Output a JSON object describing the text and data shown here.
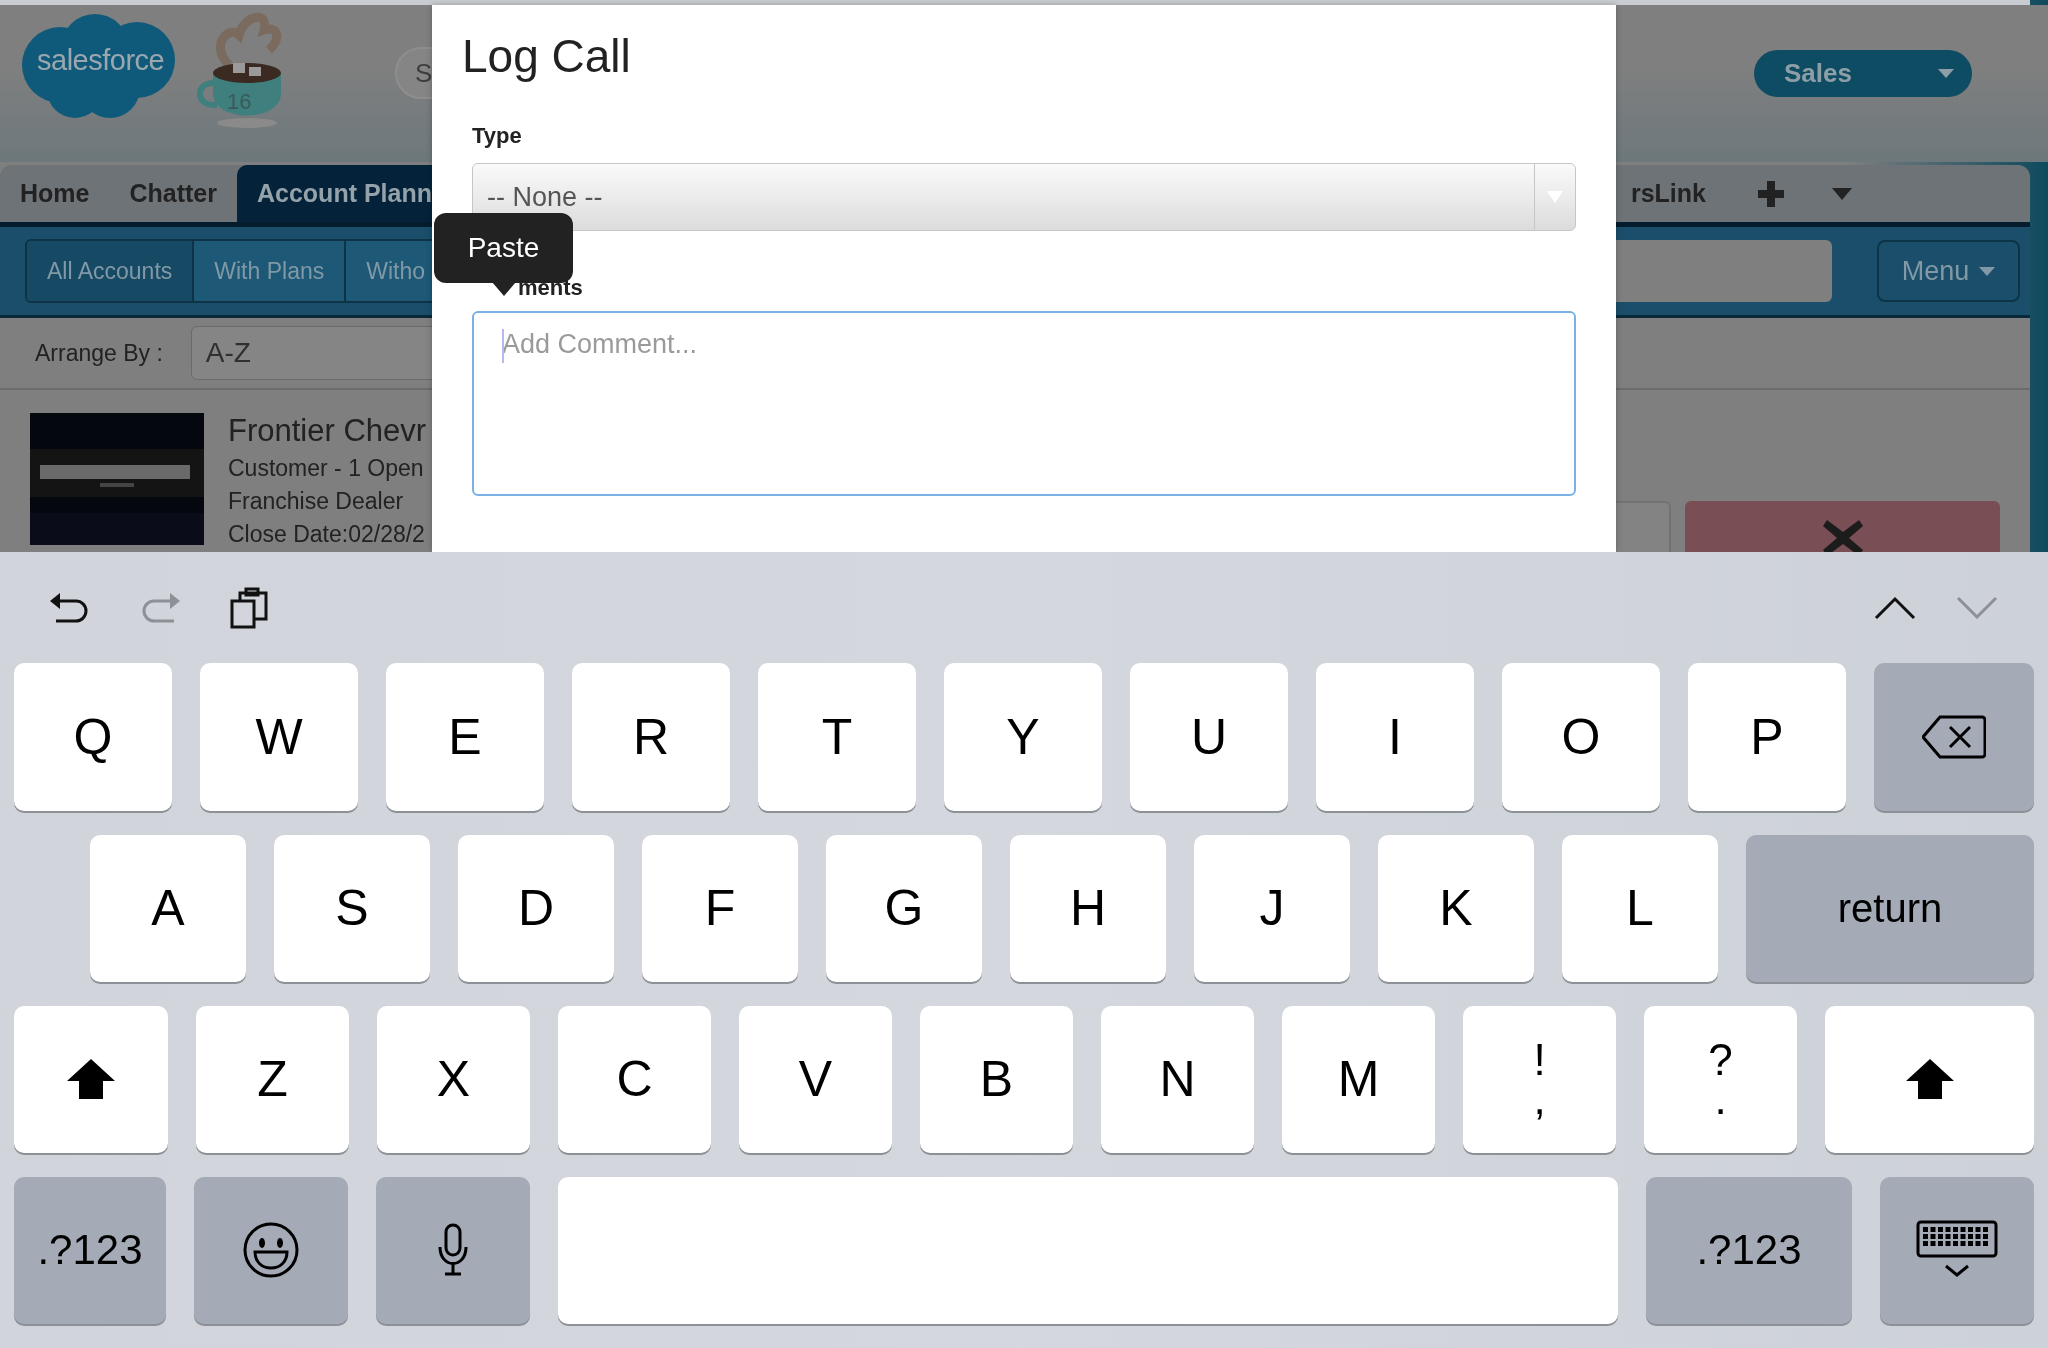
{
  "header": {
    "logo_text": "salesforce",
    "mug_badge": "16",
    "search_placeholder": "S",
    "app_menu": "Sales"
  },
  "nav_tabs": [
    {
      "label": "Home",
      "selected": false
    },
    {
      "label": "Chatter",
      "selected": false
    },
    {
      "label": "Account Plann",
      "selected": true
    }
  ],
  "nav_tabs_right": [
    {
      "label": "rsLink",
      "selected": false
    }
  ],
  "filter_tabs": [
    {
      "label": "All Accounts",
      "selected": true
    },
    {
      "label": "With Plans",
      "selected": false
    },
    {
      "label": "Witho",
      "selected": false
    }
  ],
  "menu_button": "Menu",
  "arrange": {
    "label": "Arrange By :",
    "value": "A-Z"
  },
  "accounts": [
    {
      "kind": "picture",
      "name": "Frontier Chevr",
      "lines": [
        "Customer - 1 Open",
        "Franchise Dealer",
        "Close Date:02/28/2"
      ]
    }
  ],
  "dialog": {
    "title": "Log Call",
    "type_label": "Type",
    "type_value": "-- None --",
    "comments_label": "ments",
    "comments_placeholder": "Add Comment..."
  },
  "tooltip": "Paste",
  "keyboard": {
    "toolbar": [
      {
        "kind": "undo",
        "disabled": false
      },
      {
        "kind": "redo",
        "disabled": true
      },
      {
        "kind": "paste",
        "disabled": false
      }
    ],
    "nav": [
      {
        "kind": "previous",
        "disabled": false
      },
      {
        "kind": "next",
        "disabled": true
      }
    ],
    "rows": [
      {
        "keys": [
          {
            "kind": "letter",
            "label": "Q"
          },
          {
            "kind": "letter",
            "label": "W"
          },
          {
            "kind": "letter",
            "label": "E"
          },
          {
            "kind": "letter",
            "label": "R"
          },
          {
            "kind": "letter",
            "label": "T"
          },
          {
            "kind": "letter",
            "label": "Y"
          },
          {
            "kind": "letter",
            "label": "U"
          },
          {
            "kind": "letter",
            "label": "I"
          },
          {
            "kind": "letter",
            "label": "O"
          },
          {
            "kind": "letter",
            "label": "P"
          },
          {
            "kind": "backspace"
          }
        ]
      },
      {
        "keys": [
          {
            "kind": "letter",
            "label": "A"
          },
          {
            "kind": "letter",
            "label": "S"
          },
          {
            "kind": "letter",
            "label": "D"
          },
          {
            "kind": "letter",
            "label": "F"
          },
          {
            "kind": "letter",
            "label": "G"
          },
          {
            "kind": "letter",
            "label": "H"
          },
          {
            "kind": "letter",
            "label": "J"
          },
          {
            "kind": "letter",
            "label": "K"
          },
          {
            "kind": "letter",
            "label": "L"
          },
          {
            "kind": "return",
            "label": "return"
          }
        ]
      },
      {
        "keys": [
          {
            "kind": "shift"
          },
          {
            "kind": "letter",
            "label": "Z"
          },
          {
            "kind": "letter",
            "label": "X"
          },
          {
            "kind": "letter",
            "label": "C"
          },
          {
            "kind": "letter",
            "label": "V"
          },
          {
            "kind": "letter",
            "label": "B"
          },
          {
            "kind": "letter",
            "label": "N"
          },
          {
            "kind": "letter",
            "label": "M"
          },
          {
            "kind": "dual",
            "top": "!",
            "bottom": ","
          },
          {
            "kind": "dual",
            "top": "?",
            "bottom": "."
          },
          {
            "kind": "shift_right"
          }
        ]
      },
      {
        "keys": [
          {
            "kind": "numbers",
            "label": ".?123"
          },
          {
            "kind": "emoji"
          },
          {
            "kind": "mic"
          },
          {
            "kind": "space"
          },
          {
            "kind": "numbers_right",
            "label": ".?123"
          },
          {
            "kind": "hide"
          }
        ]
      }
    ]
  }
}
